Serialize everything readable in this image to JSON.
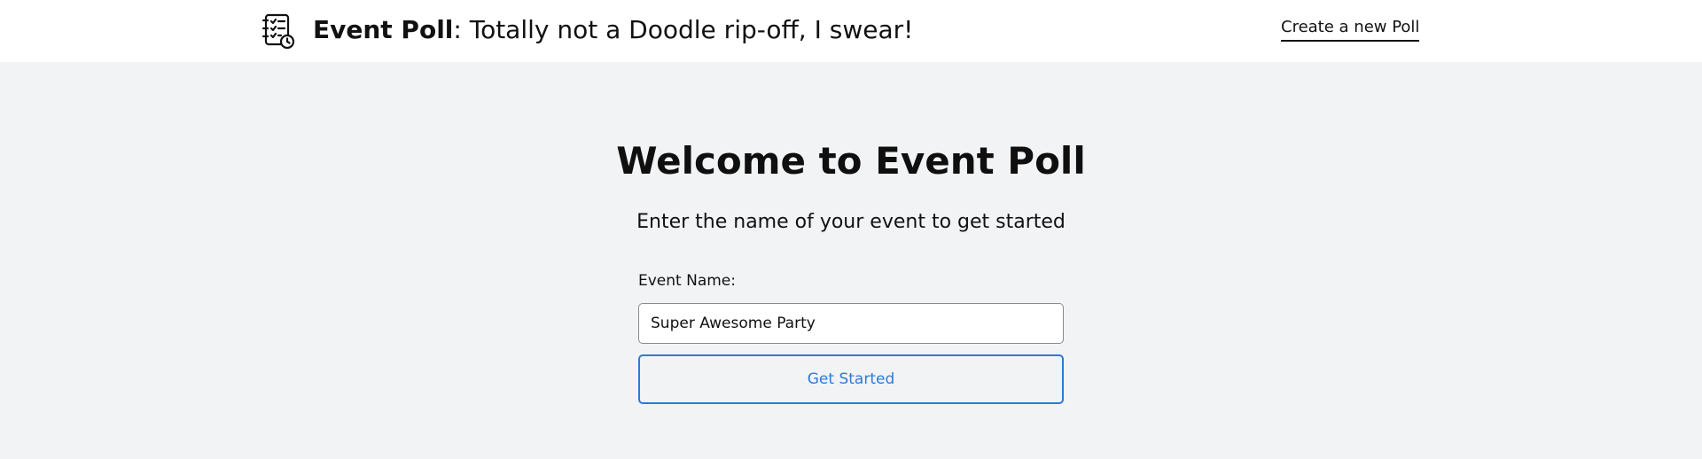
{
  "header": {
    "logo_icon": "checklist-clock-icon",
    "brand_name": "Event Poll",
    "tagline": ": Totally not a Doodle rip-off, I swear!",
    "nav_link": "Create a new Poll"
  },
  "main": {
    "heading": "Welcome to Event Poll",
    "subtitle": "Enter the name of your event to get started",
    "form": {
      "label": "Event Name:",
      "input_value": "Super Awesome Party",
      "submit_label": "Get Started"
    }
  },
  "colors": {
    "page_background": "#f2f3f5",
    "header_background": "#ffffff",
    "accent": "#2f7ad6",
    "text": "#111111"
  }
}
